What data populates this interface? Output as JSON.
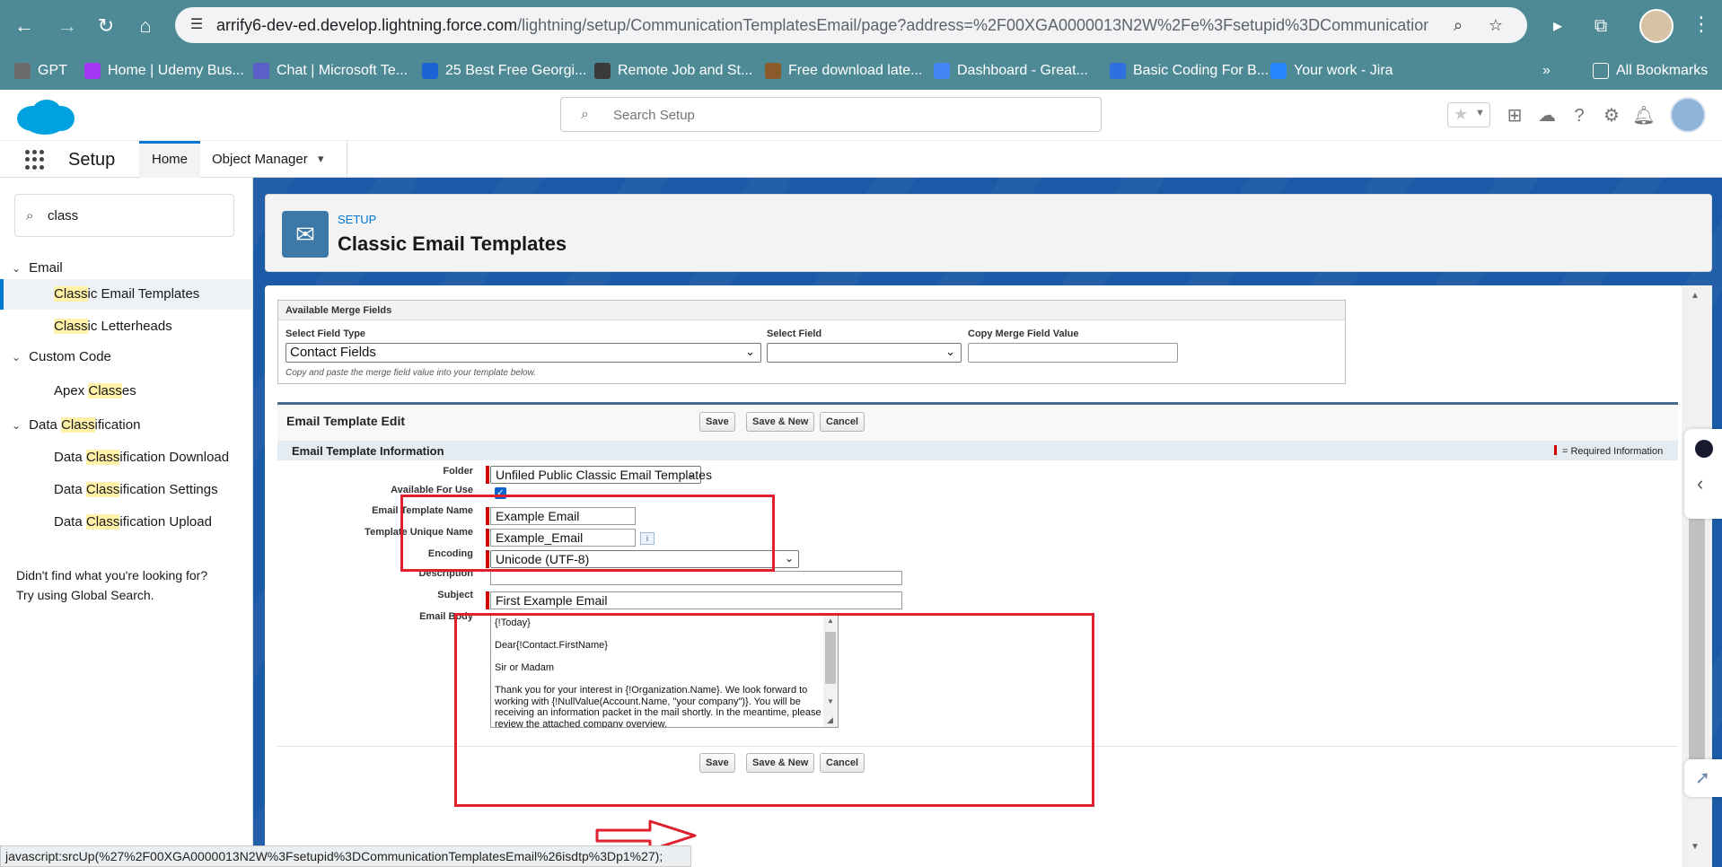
{
  "browser": {
    "url_host": "arrify6-dev-ed.develop.lightning.force.com",
    "url_path": "/lightning/setup/CommunicationTemplatesEmail/page?address=%2F00XGA0000013N2W%2Fe%3Fsetupid%3DCommunicationTempl...",
    "bookmarks": [
      {
        "label": "GPT",
        "color": "#6b6b6b"
      },
      {
        "label": "Home | Udemy Bus...",
        "color": "#a435f0"
      },
      {
        "label": "Chat | Microsoft Te...",
        "color": "#5b5fc7"
      },
      {
        "label": "25 Best Free Georgi...",
        "color": "#1e63d6"
      },
      {
        "label": "Remote Job and St...",
        "color": "#3a3a3a"
      },
      {
        "label": "Free download late...",
        "color": "#8a5a2b"
      },
      {
        "label": "Dashboard - Great...",
        "color": "#4285f4"
      },
      {
        "label": "Basic Coding For B...",
        "color": "#2f6fe0"
      },
      {
        "label": "Your work - Jira",
        "color": "#2684ff"
      }
    ],
    "all_bookmarks": "All Bookmarks",
    "status_tip": "javascript:srcUp(%27%2F00XGA0000013N2W%3Fsetupid%3DCommunicationTemplatesEmail%26isdtp%3Dp1%27);"
  },
  "header": {
    "search_placeholder": "Search Setup"
  },
  "nav": {
    "app_name": "Setup",
    "tabs": [
      "Home",
      "Object Manager"
    ]
  },
  "sidebar": {
    "quick_find_value": "class",
    "items": [
      {
        "level": 0,
        "pre": "",
        "hl": "",
        "post": "Email",
        "selected": false
      },
      {
        "level": 1,
        "pre": "",
        "hl": "Class",
        "post": "ic Email Templates",
        "selected": true
      },
      {
        "level": 1,
        "pre": "",
        "hl": "Class",
        "post": "ic Letterheads",
        "selected": false
      },
      {
        "level": 0,
        "pre": "",
        "hl": "",
        "post": "Custom Code",
        "selected": false
      },
      {
        "level": 1,
        "pre": "Apex ",
        "hl": "Class",
        "post": "es",
        "selected": false
      },
      {
        "level": 0,
        "pre": "Data ",
        "hl": "Class",
        "post": "ification",
        "selected": false
      },
      {
        "level": 1,
        "pre": "Data ",
        "hl": "Class",
        "post": "ification Download",
        "selected": false
      },
      {
        "level": 1,
        "pre": "Data ",
        "hl": "Class",
        "post": "ification Settings",
        "selected": false
      },
      {
        "level": 1,
        "pre": "Data ",
        "hl": "Class",
        "post": "ification Upload",
        "selected": false
      }
    ],
    "not_found_line1": "Didn't find what you're looking for?",
    "not_found_line2": "Try using Global Search."
  },
  "page_header": {
    "eyebrow": "SETUP",
    "title": "Classic Email Templates"
  },
  "merge_fields": {
    "title": "Available Merge Fields",
    "field_type_label": "Select Field Type",
    "field_type_value": "Contact Fields",
    "field_label": "Select Field",
    "field_value": "",
    "copy_label": "Copy Merge Field Value",
    "copy_value": "",
    "hint": "Copy and paste the merge field value into your template below."
  },
  "edit": {
    "title": "Email Template Edit",
    "save": "Save",
    "save_new": "Save & New",
    "cancel": "Cancel",
    "section_title": "Email Template Information",
    "required_info": "= Required Information",
    "folder_label": "Folder",
    "folder_value": "Unfiled Public Classic Email Templates",
    "available_label": "Available For Use",
    "available_checked": true,
    "name_label": "Email Template Name",
    "name_value": "Example Email",
    "unique_label": "Template Unique Name",
    "unique_value": "Example_Email",
    "encoding_label": "Encoding",
    "encoding_value": "Unicode (UTF-8)",
    "description_label": "Description",
    "description_value": "",
    "subject_label": "Subject",
    "subject_value": "First Example Email",
    "body_label": "Email Body",
    "body_lines": [
      "{!Today}",
      "",
      "Dear{!Contact.FirstName}",
      "",
      "Sir or Madam",
      "",
      "Thank you for your interest in {!Organization.Name}. We look forward to",
      "working with {!NullValue(Account.Name, \"your company\")}. You will be",
      "receiving an information packet in the mail shortly. In the meantime, please",
      "review the attached company overview."
    ]
  }
}
